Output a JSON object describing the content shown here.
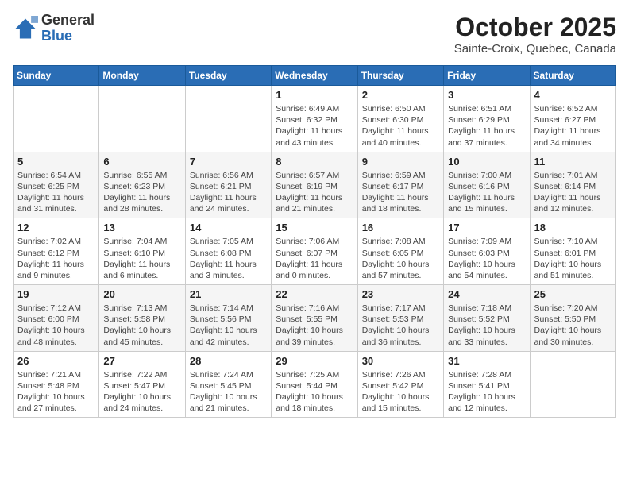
{
  "header": {
    "logo_general": "General",
    "logo_blue": "Blue",
    "month": "October 2025",
    "location": "Sainte-Croix, Quebec, Canada"
  },
  "weekdays": [
    "Sunday",
    "Monday",
    "Tuesday",
    "Wednesday",
    "Thursday",
    "Friday",
    "Saturday"
  ],
  "weeks": [
    [
      {
        "day": "",
        "info": ""
      },
      {
        "day": "",
        "info": ""
      },
      {
        "day": "",
        "info": ""
      },
      {
        "day": "1",
        "info": "Sunrise: 6:49 AM\nSunset: 6:32 PM\nDaylight: 11 hours and 43 minutes."
      },
      {
        "day": "2",
        "info": "Sunrise: 6:50 AM\nSunset: 6:30 PM\nDaylight: 11 hours and 40 minutes."
      },
      {
        "day": "3",
        "info": "Sunrise: 6:51 AM\nSunset: 6:29 PM\nDaylight: 11 hours and 37 minutes."
      },
      {
        "day": "4",
        "info": "Sunrise: 6:52 AM\nSunset: 6:27 PM\nDaylight: 11 hours and 34 minutes."
      }
    ],
    [
      {
        "day": "5",
        "info": "Sunrise: 6:54 AM\nSunset: 6:25 PM\nDaylight: 11 hours and 31 minutes."
      },
      {
        "day": "6",
        "info": "Sunrise: 6:55 AM\nSunset: 6:23 PM\nDaylight: 11 hours and 28 minutes."
      },
      {
        "day": "7",
        "info": "Sunrise: 6:56 AM\nSunset: 6:21 PM\nDaylight: 11 hours and 24 minutes."
      },
      {
        "day": "8",
        "info": "Sunrise: 6:57 AM\nSunset: 6:19 PM\nDaylight: 11 hours and 21 minutes."
      },
      {
        "day": "9",
        "info": "Sunrise: 6:59 AM\nSunset: 6:17 PM\nDaylight: 11 hours and 18 minutes."
      },
      {
        "day": "10",
        "info": "Sunrise: 7:00 AM\nSunset: 6:16 PM\nDaylight: 11 hours and 15 minutes."
      },
      {
        "day": "11",
        "info": "Sunrise: 7:01 AM\nSunset: 6:14 PM\nDaylight: 11 hours and 12 minutes."
      }
    ],
    [
      {
        "day": "12",
        "info": "Sunrise: 7:02 AM\nSunset: 6:12 PM\nDaylight: 11 hours and 9 minutes."
      },
      {
        "day": "13",
        "info": "Sunrise: 7:04 AM\nSunset: 6:10 PM\nDaylight: 11 hours and 6 minutes."
      },
      {
        "day": "14",
        "info": "Sunrise: 7:05 AM\nSunset: 6:08 PM\nDaylight: 11 hours and 3 minutes."
      },
      {
        "day": "15",
        "info": "Sunrise: 7:06 AM\nSunset: 6:07 PM\nDaylight: 11 hours and 0 minutes."
      },
      {
        "day": "16",
        "info": "Sunrise: 7:08 AM\nSunset: 6:05 PM\nDaylight: 10 hours and 57 minutes."
      },
      {
        "day": "17",
        "info": "Sunrise: 7:09 AM\nSunset: 6:03 PM\nDaylight: 10 hours and 54 minutes."
      },
      {
        "day": "18",
        "info": "Sunrise: 7:10 AM\nSunset: 6:01 PM\nDaylight: 10 hours and 51 minutes."
      }
    ],
    [
      {
        "day": "19",
        "info": "Sunrise: 7:12 AM\nSunset: 6:00 PM\nDaylight: 10 hours and 48 minutes."
      },
      {
        "day": "20",
        "info": "Sunrise: 7:13 AM\nSunset: 5:58 PM\nDaylight: 10 hours and 45 minutes."
      },
      {
        "day": "21",
        "info": "Sunrise: 7:14 AM\nSunset: 5:56 PM\nDaylight: 10 hours and 42 minutes."
      },
      {
        "day": "22",
        "info": "Sunrise: 7:16 AM\nSunset: 5:55 PM\nDaylight: 10 hours and 39 minutes."
      },
      {
        "day": "23",
        "info": "Sunrise: 7:17 AM\nSunset: 5:53 PM\nDaylight: 10 hours and 36 minutes."
      },
      {
        "day": "24",
        "info": "Sunrise: 7:18 AM\nSunset: 5:52 PM\nDaylight: 10 hours and 33 minutes."
      },
      {
        "day": "25",
        "info": "Sunrise: 7:20 AM\nSunset: 5:50 PM\nDaylight: 10 hours and 30 minutes."
      }
    ],
    [
      {
        "day": "26",
        "info": "Sunrise: 7:21 AM\nSunset: 5:48 PM\nDaylight: 10 hours and 27 minutes."
      },
      {
        "day": "27",
        "info": "Sunrise: 7:22 AM\nSunset: 5:47 PM\nDaylight: 10 hours and 24 minutes."
      },
      {
        "day": "28",
        "info": "Sunrise: 7:24 AM\nSunset: 5:45 PM\nDaylight: 10 hours and 21 minutes."
      },
      {
        "day": "29",
        "info": "Sunrise: 7:25 AM\nSunset: 5:44 PM\nDaylight: 10 hours and 18 minutes."
      },
      {
        "day": "30",
        "info": "Sunrise: 7:26 AM\nSunset: 5:42 PM\nDaylight: 10 hours and 15 minutes."
      },
      {
        "day": "31",
        "info": "Sunrise: 7:28 AM\nSunset: 5:41 PM\nDaylight: 10 hours and 12 minutes."
      },
      {
        "day": "",
        "info": ""
      }
    ]
  ]
}
